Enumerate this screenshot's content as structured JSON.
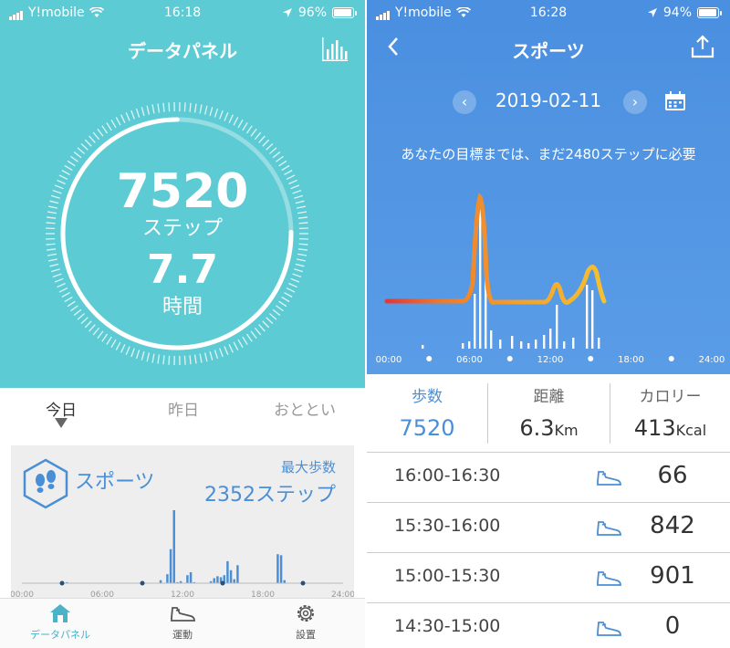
{
  "left": {
    "status": {
      "carrier": "Y!mobile",
      "time": "16:18",
      "battery": "96%",
      "battery_level": 0.96
    },
    "title": "データパネル",
    "ring": {
      "progress": 0.752
    },
    "steps": "7520",
    "steps_unit": "ステップ",
    "time_value": "7.7",
    "time_unit": "時間",
    "day_tabs": [
      "今日",
      "昨日",
      "おととい"
    ],
    "sports": {
      "label": "スポーツ",
      "max_label": "最大歩数",
      "max_value": "2352ステップ",
      "bars": [
        0,
        0,
        0,
        0,
        0,
        0,
        0,
        0,
        0,
        0,
        0,
        0,
        0,
        1,
        0,
        0,
        0,
        0,
        0,
        0,
        0,
        0,
        0,
        0,
        0,
        0,
        0,
        0,
        0,
        0,
        0,
        0,
        0,
        0,
        0,
        0,
        0,
        0,
        0,
        0,
        0,
        3,
        0,
        9,
        34,
        73,
        1,
        2,
        0,
        8,
        11,
        1,
        0,
        0,
        0,
        0,
        2,
        5,
        7,
        6,
        8,
        22,
        13,
        4,
        18,
        0,
        0,
        0,
        0,
        0,
        0,
        0,
        0,
        0,
        0,
        0,
        29,
        28,
        3,
        0,
        0,
        0,
        0,
        0,
        0,
        0,
        0,
        0,
        0,
        0,
        0,
        0,
        0,
        0,
        0,
        0
      ],
      "axis": [
        "00:00",
        "06:00",
        "12:00",
        "18:00",
        "24:00"
      ]
    },
    "tabbar": [
      "データパネル",
      "運動",
      "設置"
    ]
  },
  "right": {
    "status": {
      "carrier": "Y!mobile",
      "time": "16:28",
      "battery": "94%",
      "battery_level": 0.94
    },
    "title": "スポーツ",
    "date": "2019-02-11",
    "goal_message": "あなたの目標までは、まだ2480ステップに必要",
    "chart_axis": [
      "00:00",
      "06:00",
      "12:00",
      "18:00",
      "24:00"
    ],
    "summary": [
      {
        "label": "歩数",
        "value": "7520",
        "unit": ""
      },
      {
        "label": "距離",
        "value": "6.3",
        "unit": "Km"
      },
      {
        "label": "カロリー",
        "value": "413",
        "unit": "Kcal"
      }
    ],
    "rows": [
      {
        "time": "16:00-16:30",
        "value": "66"
      },
      {
        "time": "15:30-16:00",
        "value": "842"
      },
      {
        "time": "15:00-15:30",
        "value": "901"
      },
      {
        "time": "14:30-15:00",
        "value": "0"
      }
    ]
  },
  "colors": {
    "teal": "#5ccbd3",
    "blue": "#4a8fe0",
    "accent": "#4a8fd6"
  }
}
